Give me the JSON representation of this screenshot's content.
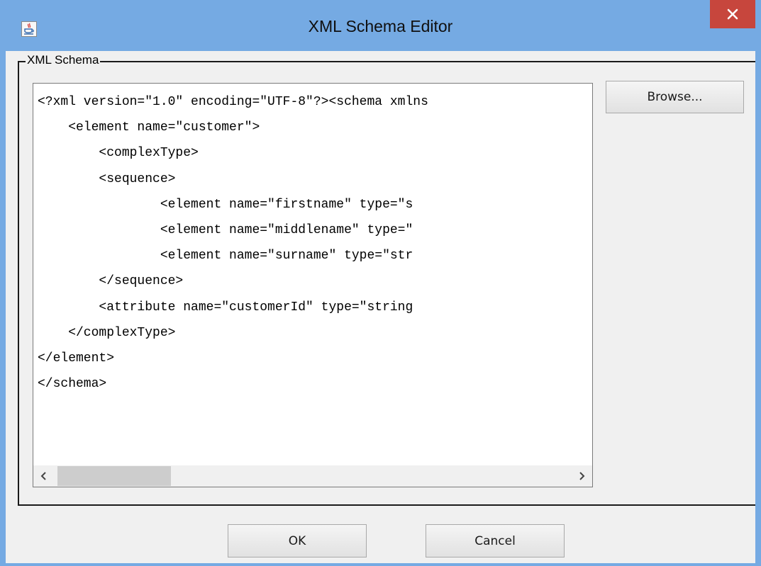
{
  "window": {
    "title": "XML Schema Editor",
    "app_icon": "java-cup-icon",
    "close_icon": "close-icon",
    "accent_color": "#75aae3",
    "close_color": "#c7463d"
  },
  "group": {
    "label": "XML Schema"
  },
  "editor": {
    "lines": [
      "<?xml version=\"1.0\" encoding=\"UTF-8\"?><schema xmlns",
      "    <element name=\"customer\">",
      "        <complexType>",
      "        <sequence>",
      "                <element name=\"firstname\" type=\"s",
      "                <element name=\"middlename\" type=\"",
      "                <element name=\"surname\" type=\"str",
      "        </sequence>",
      "        <attribute name=\"customerId\" type=\"string",
      "    </complexType>",
      "</element>",
      "</schema>"
    ]
  },
  "scrollbar": {
    "left_icon": "chevron-left-icon",
    "right_icon": "chevron-right-icon"
  },
  "buttons": {
    "browse": "Browse...",
    "ok": "OK",
    "cancel": "Cancel"
  }
}
